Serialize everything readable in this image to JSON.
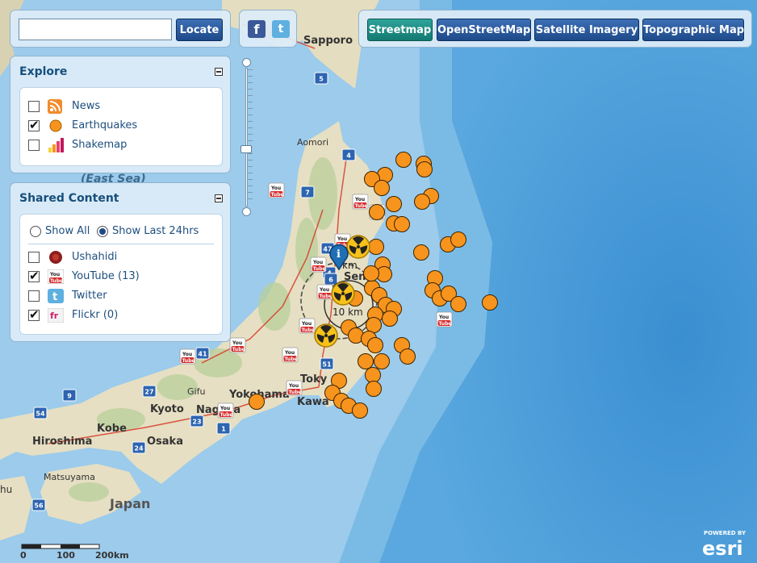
{
  "search": {
    "placeholder": "",
    "button_label": "Locate"
  },
  "social": {
    "facebook_icon": "facebook-icon",
    "twitter_icon": "twitter-icon"
  },
  "basemaps": [
    {
      "label": "Streetmap",
      "active": true
    },
    {
      "label": "OpenStreetMap",
      "active": false
    },
    {
      "label": "Satellite Imagery",
      "active": false
    },
    {
      "label": "Topographic Map",
      "active": false
    }
  ],
  "explore": {
    "title": "Explore",
    "items": [
      {
        "label": "News",
        "checked": false,
        "icon": "rss-icon"
      },
      {
        "label": "Earthquakes",
        "checked": true,
        "icon": "earthquake-dot-icon"
      },
      {
        "label": "Shakemap",
        "checked": false,
        "icon": "bar-chart-icon"
      }
    ]
  },
  "shared": {
    "title": "Shared Content",
    "filters": [
      {
        "label": "Show All",
        "selected": false
      },
      {
        "label": "Show Last 24hrs",
        "selected": true
      }
    ],
    "items": [
      {
        "label": "Ushahidi",
        "checked": false,
        "icon": "ushahidi-icon"
      },
      {
        "label": "YouTube (13)",
        "checked": true,
        "icon": "youtube-icon"
      },
      {
        "label": "Twitter",
        "checked": false,
        "icon": "twitter-icon"
      },
      {
        "label": "Flickr (0)",
        "checked": true,
        "icon": "flickr-icon"
      }
    ]
  },
  "map": {
    "labels": {
      "east_sea": "(East Sea)",
      "sapporo": "Sapporo",
      "aomori": "Aomori",
      "sendai": "Send",
      "tokyo": "Toky",
      "yokohama": "Yokohama",
      "kawasaki": "Kawa",
      "kyoto": "Kyoto",
      "kobe": "Kobe",
      "osaka": "Osaka",
      "hiroshima": "Hiroshima",
      "matsuyama": "Matsuyama",
      "gifu": "Gifu",
      "nagoya": "Nagoya",
      "japan": "Japan",
      "hu": "hu"
    },
    "ring_labels": {
      "inner": "10 km",
      "outer": "km"
    },
    "youtube_label": "You Tube",
    "route_shields": [
      "5",
      "4",
      "43",
      "7",
      "106",
      "47",
      "13",
      "4",
      "6",
      "41",
      "50",
      "51",
      "9",
      "27",
      "54",
      "23",
      "24",
      "1",
      "56"
    ],
    "scalebar": {
      "ticks": [
        "0",
        "100",
        "200km"
      ]
    },
    "attribution": {
      "powered_by": "POWERED BY",
      "brand": "esri"
    }
  },
  "colors": {
    "ocean": "#8cc4e8",
    "land": "#e6dfc3",
    "quake": "#f7941d",
    "button": "#1e4a8a",
    "button_active": "#179187",
    "panel_title": "#174f7c"
  }
}
